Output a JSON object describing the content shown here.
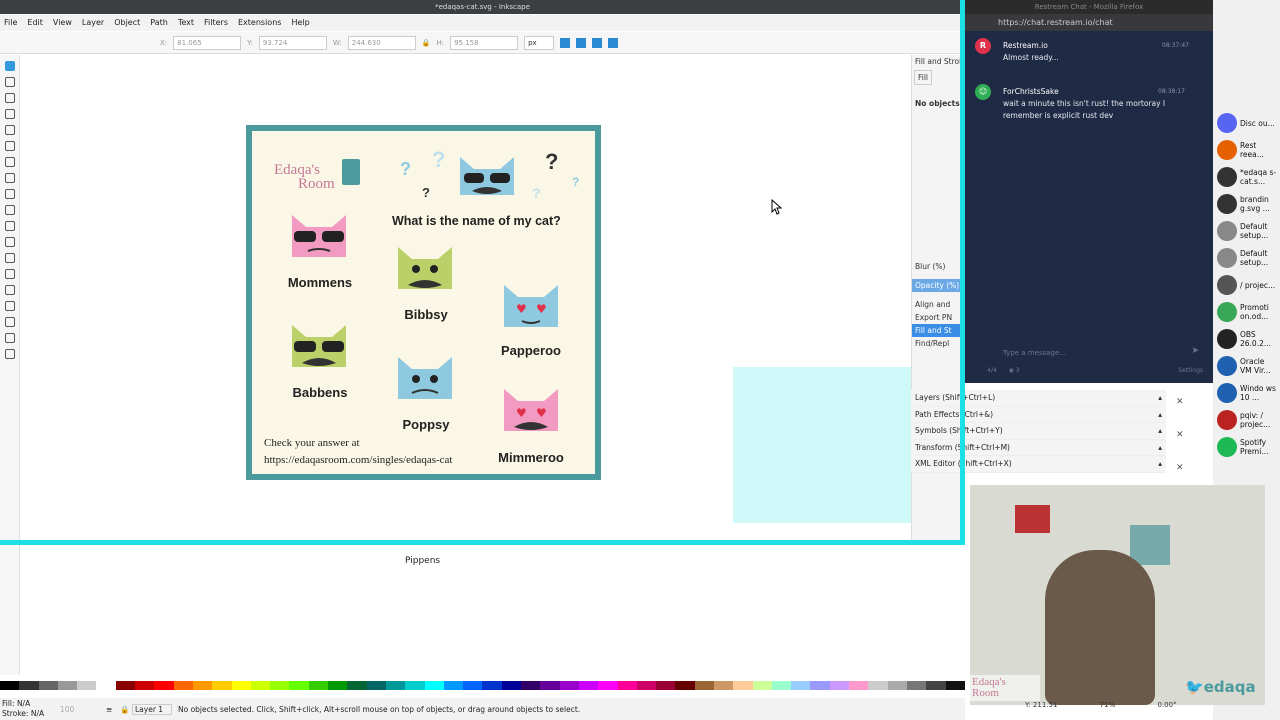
{
  "window": {
    "title": "*edaqas-cat.svg - Inkscape"
  },
  "menu": [
    "File",
    "Edit",
    "View",
    "Layer",
    "Object",
    "Path",
    "Text",
    "Filters",
    "Extensions",
    "Help"
  ],
  "toolcontrols": {
    "x_label": "X:",
    "x": "81.065",
    "y_label": "Y:",
    "y": "93.724",
    "w_label": "W:",
    "w": "244.630",
    "h_label": "H:",
    "h": "95.158",
    "unit": "px"
  },
  "card": {
    "brand_line1": "Edaqa's",
    "brand_line2": "Room",
    "question": "What is the name of my cat?",
    "cats": [
      {
        "name": "Mommens",
        "color": "#f29ac1"
      },
      {
        "name": "Bibbsy",
        "color": "#bcd06a"
      },
      {
        "name": "Papperoo",
        "color": "#8ec9e0"
      },
      {
        "name": "Babbens",
        "color": "#bcd06a"
      },
      {
        "name": "Poppsy",
        "color": "#8ec9e0"
      },
      {
        "name": "Mimmeroo",
        "color": "#f29ac1"
      }
    ],
    "answer_line1": "Check your answer at",
    "answer_line2": "https://edaqasroom.com/singles/edaqas-cat",
    "question_marks": [
      "?",
      "?",
      "?",
      "?",
      "?",
      "?"
    ]
  },
  "canvas": {
    "below_label": "Pippens"
  },
  "dock": {
    "tab1": "Fill and Stroke",
    "fill_tab": "Fill",
    "no_objects": "No objects",
    "blur": "Blur (%)",
    "opacity": "Opacity (%)",
    "align": "Align and",
    "export": "Export PN",
    "fill_stroke": "Fill and St",
    "find": "Find/Repl"
  },
  "dialogs": [
    {
      "label": "Layers (Shift+Ctrl+L)"
    },
    {
      "label": "Path Effects (Ctrl+&)"
    },
    {
      "label": "Symbols (Shift+Ctrl+Y)"
    },
    {
      "label": "Transform (Shift+Ctrl+M)"
    },
    {
      "label": "XML Editor (Shift+Ctrl+X)"
    }
  ],
  "status": {
    "fill_label": "Fill:",
    "fill": "N/A",
    "stroke_label": "Stroke:",
    "stroke": "N/A",
    "opacity": "100",
    "layer": "Layer 1",
    "message": "No objects selected. Click, Shift+click, Alt+scroll mouse on top of objects, or drag around objects to select.",
    "y_coord": "Y: 211.51",
    "zoom": "71%",
    "rotation": "0.00°"
  },
  "chat": {
    "window_title": "Restream Chat - Mozilla Firefox",
    "url": "https://chat.restream.io/chat",
    "messages": [
      {
        "user": "Restream.io",
        "time": "08:37:47",
        "text": "Almost ready...",
        "avatar": "R"
      },
      {
        "user": "ForChristsSake",
        "time": "08:38:17",
        "text": "wait a minute this isn't rust! the mortoray I remember is explicit rust dev",
        "avatar": "☺"
      }
    ],
    "input_placeholder": "Type a message...",
    "counts": "4/4",
    "viewers": "3",
    "settings": "Settings"
  },
  "taskbar": [
    {
      "label": "Disc ou...",
      "color": "#5865f2"
    },
    {
      "label": "Rest reea...",
      "color": "#e66000"
    },
    {
      "label": "*edaqa s-cat.s...",
      "color": "#333"
    },
    {
      "label": "brandin g.svg ...",
      "color": "#333"
    },
    {
      "label": "Default setup...",
      "color": "#888"
    },
    {
      "label": "Default setup...",
      "color": "#888"
    },
    {
      "label": "/ projec...",
      "color": "#555"
    },
    {
      "label": "Promoti on.od...",
      "color": "#3aa757"
    },
    {
      "label": "OBS 26.0.2...",
      "color": "#222"
    },
    {
      "label": "Oracle VM Vir...",
      "color": "#2060b0"
    },
    {
      "label": "Windo ws 10 ...",
      "color": "#2060b0"
    },
    {
      "label": "pqiv: / projec...",
      "color": "#b22"
    },
    {
      "label": "Spotify Premi...",
      "color": "#1db954"
    }
  ],
  "webcam": {
    "brand_left_1": "Edaqa's",
    "brand_left_2": "Room",
    "brand_right": "edaqa"
  },
  "palette": [
    "#000",
    "#333",
    "#666",
    "#999",
    "#ccc",
    "#fff",
    "#800",
    "#c00",
    "#f00",
    "#f60",
    "#f90",
    "#fc0",
    "#ff0",
    "#cf0",
    "#9f0",
    "#6f0",
    "#3c0",
    "#090",
    "#063",
    "#066",
    "#099",
    "#0cc",
    "#0ff",
    "#09f",
    "#06f",
    "#03c",
    "#009",
    "#306",
    "#609",
    "#90c",
    "#c0f",
    "#f0f",
    "#f09",
    "#c06",
    "#903",
    "#600",
    "#963",
    "#c96",
    "#fc9",
    "#cf9",
    "#9fc",
    "#9cf",
    "#99f",
    "#c9f",
    "#f9c",
    "#ccc",
    "#aaa",
    "#777",
    "#444",
    "#111"
  ]
}
